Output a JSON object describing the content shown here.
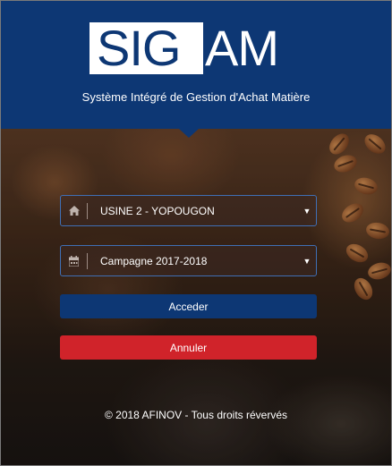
{
  "header": {
    "logo_left": "SIG",
    "logo_right": "AM",
    "subtitle": "Système Intégré de Gestion d'Achat Matière"
  },
  "form": {
    "factory_select": {
      "icon": "home-icon",
      "value": "USINE 2 - YOPOUGON"
    },
    "campaign_select": {
      "icon": "calendar-icon",
      "value": "Campagne 2017-2018"
    },
    "access_label": "Acceder",
    "cancel_label": "Annuler"
  },
  "footer": {
    "copyright": "© 2018 AFINOV - Tous droits révervés"
  },
  "colors": {
    "brand_blue": "#0d3774",
    "cancel_red": "#d0232a",
    "select_border": "#3f6fb5"
  }
}
